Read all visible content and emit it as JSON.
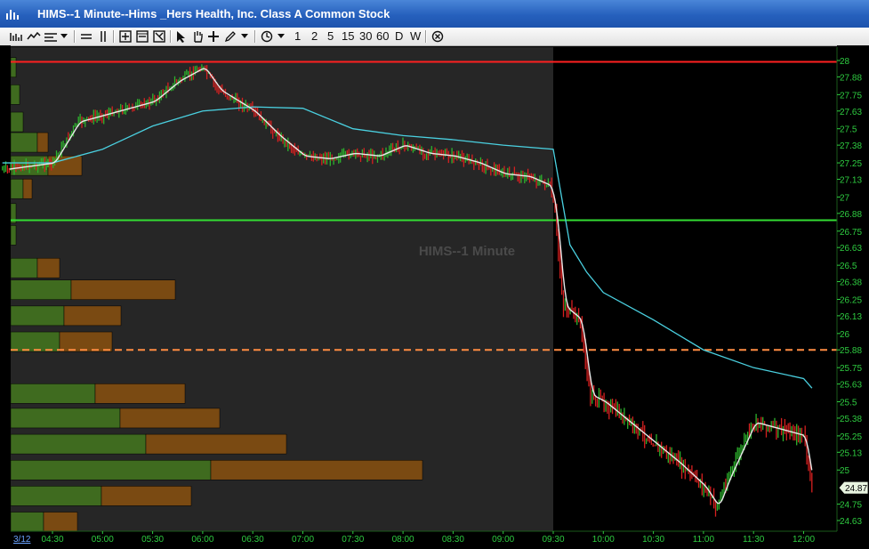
{
  "window": {
    "title": "HIMS--1 Minute--Hims _Hers Health, Inc. Class A Common Stock"
  },
  "toolbar": {
    "icons": [
      "chart-style-icon",
      "draw-style-icon",
      "indicator-icon",
      "dropdown-icon",
      "horizontal-lines-icon",
      "vertical-lines-icon",
      "zoom-fit-icon",
      "zoom-out-icon",
      "zoom-custom-icon",
      "pointer-icon",
      "hand-icon",
      "crosshair-icon",
      "pencil-icon",
      "dropdown-icon",
      "clock-icon",
      "dropdown-icon",
      "close-circle-icon"
    ],
    "intervals": [
      "1",
      "2",
      "5",
      "15",
      "30",
      "60",
      "D",
      "W"
    ]
  },
  "chart_data": {
    "type": "candlestick",
    "title": "HIMS--1 Minute",
    "x_start_label": "3/12",
    "x_tick_labels": [
      "04:30",
      "05:00",
      "05:30",
      "06:00",
      "06:30",
      "07:00",
      "07:30",
      "08:00",
      "08:30",
      "09:00",
      "09:30",
      "10:00",
      "10:30",
      "11:00",
      "11:30",
      "12:00"
    ],
    "y_tick_labels": [
      "28",
      "27.88",
      "27.75",
      "27.63",
      "27.5",
      "27.38",
      "27.25",
      "27.13",
      "27",
      "26.88",
      "26.75",
      "26.63",
      "26.5",
      "26.38",
      "26.25",
      "26.13",
      "26",
      "25.88",
      "25.75",
      "25.63",
      "25.5",
      "25.38",
      "25.25",
      "25.13",
      "25",
      "24.75",
      "24.63"
    ],
    "ylim": [
      24.58,
      28.05
    ],
    "last_price": "24.87",
    "session_split": "09:30",
    "colors": {
      "up": "#2db32d",
      "down": "#d62020",
      "premarket_bg": "#262626",
      "market_bg": "#000000",
      "grid_text": "#2ecc40",
      "vwap": "#4ad0e0",
      "ma": "#e8e8e8"
    },
    "reference_lines": [
      {
        "name": "high-line",
        "price": 27.99,
        "color": "#ff2020",
        "style": "solid"
      },
      {
        "name": "support-line",
        "price": 26.83,
        "color": "#33dd33",
        "style": "solid"
      },
      {
        "name": "prior-close-line",
        "price": 25.88,
        "color": "#ff8c42",
        "style": "dashed"
      }
    ],
    "price_path": [
      [
        "04:00",
        27.2
      ],
      [
        "04:30",
        27.25
      ],
      [
        "04:45",
        27.55
      ],
      [
        "05:00",
        27.6
      ],
      [
        "05:15",
        27.65
      ],
      [
        "05:30",
        27.7
      ],
      [
        "05:45",
        27.85
      ],
      [
        "06:00",
        27.95
      ],
      [
        "06:10",
        27.78
      ],
      [
        "06:30",
        27.63
      ],
      [
        "06:45",
        27.45
      ],
      [
        "07:00",
        27.3
      ],
      [
        "07:15",
        27.28
      ],
      [
        "07:30",
        27.32
      ],
      [
        "07:45",
        27.3
      ],
      [
        "08:00",
        27.38
      ],
      [
        "08:15",
        27.32
      ],
      [
        "08:30",
        27.3
      ],
      [
        "08:45",
        27.25
      ],
      [
        "09:00",
        27.17
      ],
      [
        "09:15",
        27.15
      ],
      [
        "09:28",
        27.08
      ],
      [
        "09:31",
        26.88
      ],
      [
        "09:36",
        26.2
      ],
      [
        "09:41",
        26.15
      ],
      [
        "09:46",
        26.1
      ],
      [
        "09:52",
        25.55
      ],
      [
        "10:00",
        25.5
      ],
      [
        "10:15",
        25.35
      ],
      [
        "10:30",
        25.2
      ],
      [
        "10:45",
        25.05
      ],
      [
        "11:00",
        24.88
      ],
      [
        "11:08",
        24.73
      ],
      [
        "11:15",
        24.95
      ],
      [
        "11:30",
        25.35
      ],
      [
        "11:45",
        25.3
      ],
      [
        "12:00",
        25.25
      ],
      [
        "12:05",
        24.87
      ]
    ],
    "vwap_path": [
      [
        "04:00",
        27.25
      ],
      [
        "04:30",
        27.25
      ],
      [
        "05:00",
        27.35
      ],
      [
        "05:30",
        27.52
      ],
      [
        "06:00",
        27.63
      ],
      [
        "06:30",
        27.66
      ],
      [
        "07:00",
        27.65
      ],
      [
        "07:30",
        27.5
      ],
      [
        "08:00",
        27.45
      ],
      [
        "08:30",
        27.42
      ],
      [
        "09:00",
        27.38
      ],
      [
        "09:30",
        27.35
      ],
      [
        "09:40",
        26.65
      ],
      [
        "09:50",
        26.45
      ],
      [
        "10:00",
        26.3
      ],
      [
        "10:30",
        26.1
      ],
      [
        "11:00",
        25.88
      ],
      [
        "11:30",
        25.75
      ],
      [
        "12:00",
        25.67
      ],
      [
        "12:05",
        25.6
      ]
    ],
    "volume_profile": [
      {
        "price": 27.95,
        "buy": 6,
        "sell": 0
      },
      {
        "price": 27.75,
        "buy": 10,
        "sell": 0
      },
      {
        "price": 27.55,
        "buy": 14,
        "sell": 0
      },
      {
        "price": 27.4,
        "buy": 30,
        "sell": 12
      },
      {
        "price": 27.23,
        "buy": 42,
        "sell": 38
      },
      {
        "price": 27.06,
        "buy": 14,
        "sell": 10
      },
      {
        "price": 26.88,
        "buy": 6,
        "sell": 0
      },
      {
        "price": 26.72,
        "buy": 6,
        "sell": 0
      },
      {
        "price": 26.48,
        "buy": 30,
        "sell": 25
      },
      {
        "price": 26.32,
        "buy": 68,
        "sell": 117
      },
      {
        "price": 26.13,
        "buy": 60,
        "sell": 64
      },
      {
        "price": 25.94,
        "buy": 55,
        "sell": 59
      },
      {
        "price": 25.56,
        "buy": 95,
        "sell": 101
      },
      {
        "price": 25.38,
        "buy": 123,
        "sell": 112
      },
      {
        "price": 25.19,
        "buy": 152,
        "sell": 158
      },
      {
        "price": 25.0,
        "buy": 225,
        "sell": 238
      },
      {
        "price": 24.81,
        "buy": 102,
        "sell": 101
      },
      {
        "price": 24.62,
        "buy": 37,
        "sell": 38
      }
    ]
  }
}
